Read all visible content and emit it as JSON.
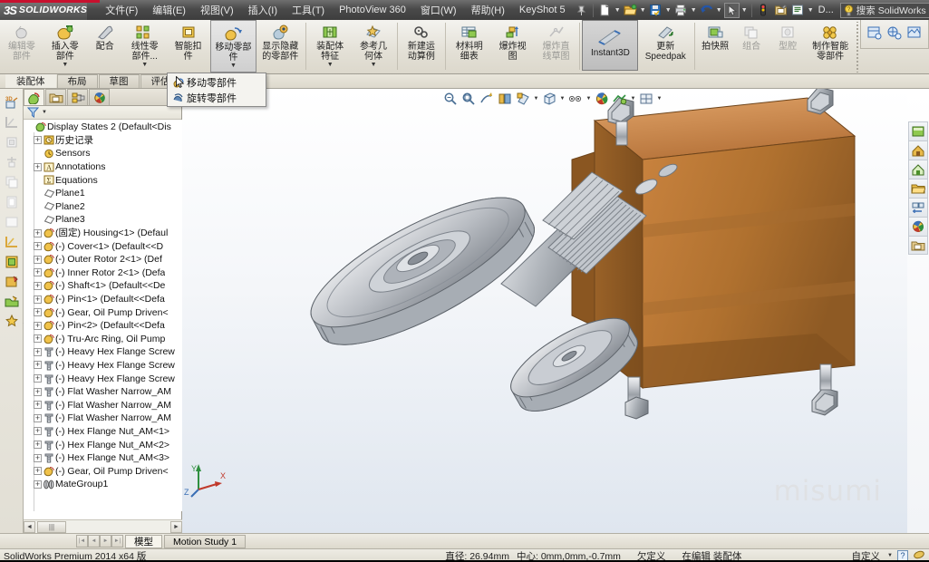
{
  "titlebar": {
    "brand_ds": "3S",
    "brand_name": "SOLIDWORKS",
    "menus": [
      {
        "label": "文件(F)",
        "name": "menu-file"
      },
      {
        "label": "编辑(E)",
        "name": "menu-edit"
      },
      {
        "label": "视图(V)",
        "name": "menu-view"
      },
      {
        "label": "插入(I)",
        "name": "menu-insert"
      },
      {
        "label": "工具(T)",
        "name": "menu-tools"
      },
      {
        "label": "PhotoView 360",
        "name": "menu-photoview"
      },
      {
        "label": "窗口(W)",
        "name": "menu-window"
      },
      {
        "label": "帮助(H)",
        "name": "menu-help"
      },
      {
        "label": "KeyShot 5",
        "name": "menu-keyshot"
      }
    ],
    "doc_button": "D...",
    "search_label": "搜索 SolidWorks",
    "minimize": "—",
    "restore": "❐",
    "close": "✕"
  },
  "ribbon": {
    "buttons": [
      {
        "label": "编辑零部件",
        "name": "edit-component",
        "dim": true,
        "dropdown": false
      },
      {
        "label": "插入零部件",
        "name": "insert-component",
        "dim": false,
        "dropdown": true
      },
      {
        "label": "配合",
        "name": "mate",
        "dim": false,
        "dropdown": false
      },
      {
        "label": "线性零部件...",
        "name": "linear-component-pattern",
        "dim": false,
        "dropdown": true
      },
      {
        "label": "智能扣件",
        "name": "smart-fasteners",
        "dim": false,
        "dropdown": false
      },
      {
        "label": "移动零部件",
        "name": "move-component",
        "dim": false,
        "dropdown": true,
        "state": "active"
      },
      {
        "label": "显示隐藏的零部件",
        "name": "show-hidden-components",
        "dim": false,
        "dropdown": false
      },
      {
        "label": "装配体特征",
        "name": "assembly-features",
        "dim": false,
        "dropdown": true
      },
      {
        "label": "参考几何体",
        "name": "reference-geometry",
        "dim": false,
        "dropdown": true
      },
      {
        "label": "新建运动算例",
        "name": "new-motion-study",
        "dim": false,
        "dropdown": false
      },
      {
        "label": "材料明细表",
        "name": "bill-of-materials",
        "dim": false,
        "dropdown": false
      },
      {
        "label": "爆炸视图",
        "name": "exploded-view",
        "dim": false,
        "dropdown": false
      },
      {
        "label": "爆炸直线草图",
        "name": "explode-line-sketch",
        "dim": true,
        "dropdown": false
      },
      {
        "label": "Instant3D",
        "name": "instant3d",
        "dim": false,
        "dropdown": false,
        "state": "pressed"
      },
      {
        "label": "更新 Speedpak",
        "name": "update-speedpak",
        "dim": false,
        "dropdown": false
      },
      {
        "label": "拍快照",
        "name": "take-snapshot",
        "dim": false,
        "dropdown": false
      },
      {
        "label": "组合",
        "name": "combine",
        "dim": true,
        "dropdown": false
      },
      {
        "label": "型腔",
        "name": "cavity",
        "dim": true,
        "dropdown": false
      },
      {
        "label": "制作智能零部件",
        "name": "make-smart-component",
        "dim": false,
        "dropdown": false
      }
    ]
  },
  "dropdown": {
    "items": [
      {
        "label": "移动零部件",
        "name": "dropdown-move-component"
      },
      {
        "label": "旋转零部件",
        "name": "dropdown-rotate-component"
      }
    ]
  },
  "tabs": [
    {
      "label": "装配体",
      "name": "tab-assembly",
      "selected": true
    },
    {
      "label": "布局",
      "name": "tab-layout",
      "selected": false
    },
    {
      "label": "草图",
      "name": "tab-sketch",
      "selected": false
    },
    {
      "label": "评估",
      "name": "tab-evaluate",
      "selected": false
    }
  ],
  "tree": {
    "tabs": [
      "feature-manager",
      "property-manager",
      "configuration-manager",
      "display-manager"
    ],
    "nodes": [
      {
        "label": "Display States 2  (Default<Dis",
        "icon": "assembly",
        "expand": "none",
        "indent": 0
      },
      {
        "label": "历史记录",
        "icon": "history",
        "expand": "plus",
        "indent": 1
      },
      {
        "label": "Sensors",
        "icon": "sensor",
        "expand": "none",
        "indent": 1
      },
      {
        "label": "Annotations",
        "icon": "annotation",
        "expand": "plus",
        "indent": 1
      },
      {
        "label": "Equations",
        "icon": "equation",
        "expand": "none",
        "indent": 1
      },
      {
        "label": "Plane1",
        "icon": "plane",
        "expand": "none",
        "indent": 1
      },
      {
        "label": "Plane2",
        "icon": "plane",
        "expand": "none",
        "indent": 1
      },
      {
        "label": "Plane3",
        "icon": "plane",
        "expand": "none",
        "indent": 1
      },
      {
        "label": "(固定) Housing<1> (Defaul",
        "icon": "part",
        "expand": "plus",
        "indent": 1
      },
      {
        "label": "(-) Cover<1> (Default<<D",
        "icon": "part",
        "expand": "plus",
        "indent": 1
      },
      {
        "label": "(-) Outer Rotor 2<1> (Def",
        "icon": "part",
        "expand": "plus",
        "indent": 1
      },
      {
        "label": "(-) Inner Rotor 2<1> (Defa",
        "icon": "part",
        "expand": "plus",
        "indent": 1
      },
      {
        "label": "(-) Shaft<1> (Default<<De",
        "icon": "part",
        "expand": "plus",
        "indent": 1
      },
      {
        "label": "(-) Pin<1> (Default<<Defa",
        "icon": "part",
        "expand": "plus",
        "indent": 1
      },
      {
        "label": "(-) Gear, Oil Pump Driven<",
        "icon": "part",
        "expand": "plus",
        "indent": 1
      },
      {
        "label": "(-) Pin<2> (Default<<Defa",
        "icon": "part",
        "expand": "plus",
        "indent": 1
      },
      {
        "label": "(-) Tru-Arc Ring, Oil Pump",
        "icon": "part",
        "expand": "plus",
        "indent": 1
      },
      {
        "label": "(-) Heavy Hex Flange Screw",
        "icon": "fastener",
        "expand": "plus",
        "indent": 1
      },
      {
        "label": "(-) Heavy Hex Flange Screw",
        "icon": "fastener",
        "expand": "plus",
        "indent": 1
      },
      {
        "label": "(-) Heavy Hex Flange Screw",
        "icon": "fastener",
        "expand": "plus",
        "indent": 1
      },
      {
        "label": "(-) Flat Washer Narrow_AM",
        "icon": "fastener",
        "expand": "plus",
        "indent": 1
      },
      {
        "label": "(-) Flat Washer Narrow_AM",
        "icon": "fastener",
        "expand": "plus",
        "indent": 1
      },
      {
        "label": "(-) Flat Washer Narrow_AM",
        "icon": "fastener",
        "expand": "plus",
        "indent": 1
      },
      {
        "label": "(-) Hex Flange Nut_AM<1>",
        "icon": "fastener",
        "expand": "plus",
        "indent": 1
      },
      {
        "label": "(-) Hex Flange Nut_AM<2>",
        "icon": "fastener",
        "expand": "plus",
        "indent": 1
      },
      {
        "label": "(-) Hex Flange Nut_AM<3>",
        "icon": "fastener",
        "expand": "plus",
        "indent": 1
      },
      {
        "label": "(-) Gear, Oil Pump Driven<",
        "icon": "part",
        "expand": "plus",
        "indent": 1
      },
      {
        "label": "MateGroup1",
        "icon": "mategroup",
        "expand": "plus",
        "indent": 1
      }
    ]
  },
  "graphics": {
    "watermark": "misumi",
    "triad_labels": {
      "x": "X",
      "y": "Y",
      "z": "Z"
    }
  },
  "bottom": {
    "tabs": [
      {
        "label": "模型",
        "name": "bottom-tab-model",
        "selected": true
      },
      {
        "label": "Motion Study 1",
        "name": "bottom-tab-motion-study",
        "selected": false
      }
    ]
  },
  "status": {
    "product": "SolidWorks Premium 2014 x64 版",
    "diameter": "直径: 26.94mm",
    "center": "中心: 0mm,0mm,-0.7mm",
    "definition": "欠定义",
    "editing": "在编辑 装配体",
    "custom": "自定义",
    "help": "?"
  },
  "colors": {
    "brand_red": "#c8102e",
    "titlebar": "#4a4a4a",
    "ribbon_bg": "#e3e0d6",
    "accent_blue": "#2f6fb5",
    "body_orange": "#c47a3a",
    "metal_gray": "#b9bcc0"
  }
}
